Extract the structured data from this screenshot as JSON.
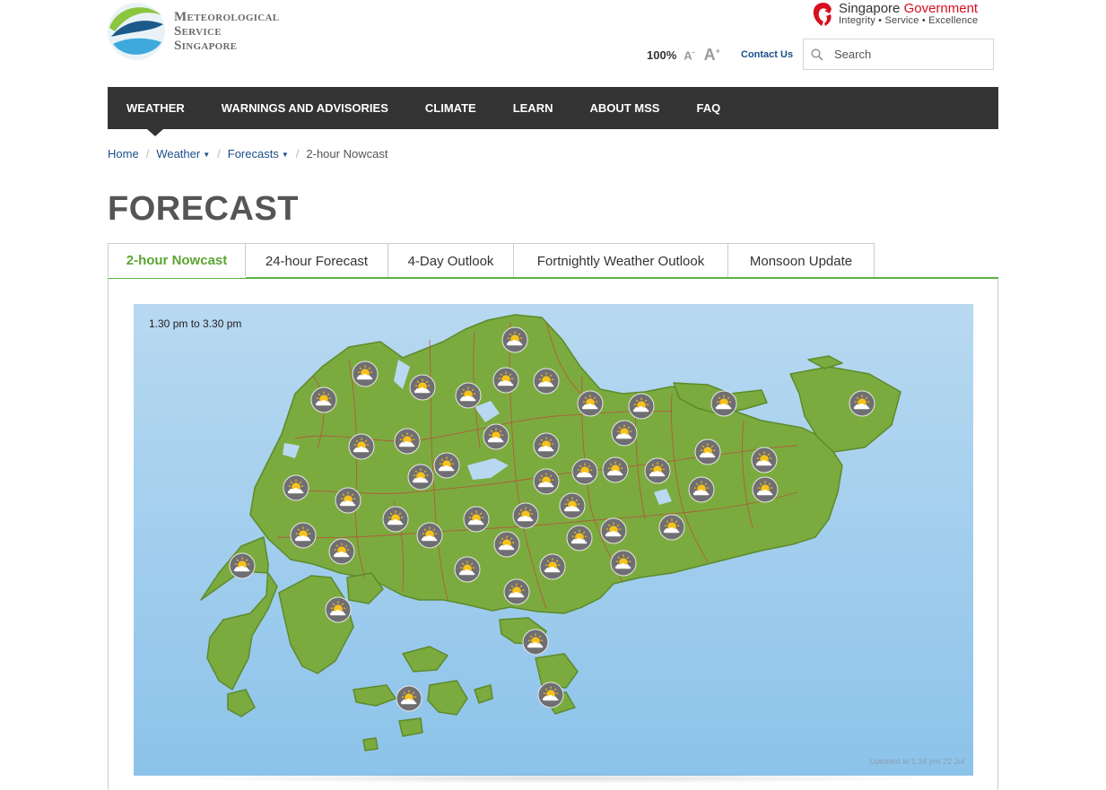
{
  "header": {
    "logo_lines": [
      "Meteorological",
      "Service",
      "Singapore"
    ],
    "gov_name_1": "Singapore",
    "gov_name_2": "Government",
    "gov_motto": "Integrity • Service • Excellence",
    "zoom_level": "100%",
    "font_smaller": "A",
    "font_smaller_sign": "-",
    "font_larger": "A",
    "font_larger_sign": "+",
    "contact": "Contact Us",
    "search_placeholder": "Search"
  },
  "nav": {
    "items": [
      "WEATHER",
      "WARNINGS AND ADVISORIES",
      "CLIMATE",
      "LEARN",
      "ABOUT MSS",
      "FAQ"
    ],
    "active_index": 0
  },
  "breadcrumb": {
    "home": "Home",
    "weather": "Weather",
    "forecasts": "Forecasts",
    "current": "2-hour Nowcast"
  },
  "page_title": "FORECAST",
  "tabs": [
    "2-hour Nowcast",
    "24-hour Forecast",
    "4-Day Outlook",
    "Fortnightly Weather Outlook",
    "Monsoon Update"
  ],
  "active_tab": 0,
  "map": {
    "period": "1.30 pm to 3.30 pm",
    "updated": "Updated at 1.34 pm 22 Jul",
    "icon": "partly-cloudy-icon",
    "colors": {
      "land": "#7bab3f",
      "sea_top": "#b8d9f1",
      "sea_bottom": "#8cc3ea",
      "accent": "#5ba532",
      "nav": "#333333"
    }
  }
}
